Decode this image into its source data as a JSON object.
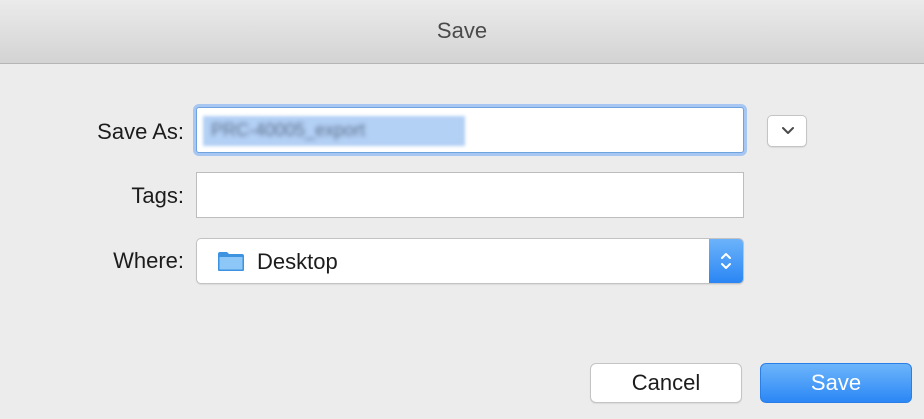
{
  "window": {
    "title": "Save"
  },
  "form": {
    "save_as_label": "Save As:",
    "save_as_value": "PRC-40005_export",
    "tags_label": "Tags:",
    "tags_value": "",
    "where_label": "Where:",
    "where_value": "Desktop",
    "where_icon": "folder-icon"
  },
  "buttons": {
    "expand_icon": "chevron-down-icon",
    "cancel_label": "Cancel",
    "save_label": "Save"
  },
  "colors": {
    "accent": "#2b87f5",
    "focus_ring": "#a7c7f2",
    "folder": "#4a9fe8"
  }
}
